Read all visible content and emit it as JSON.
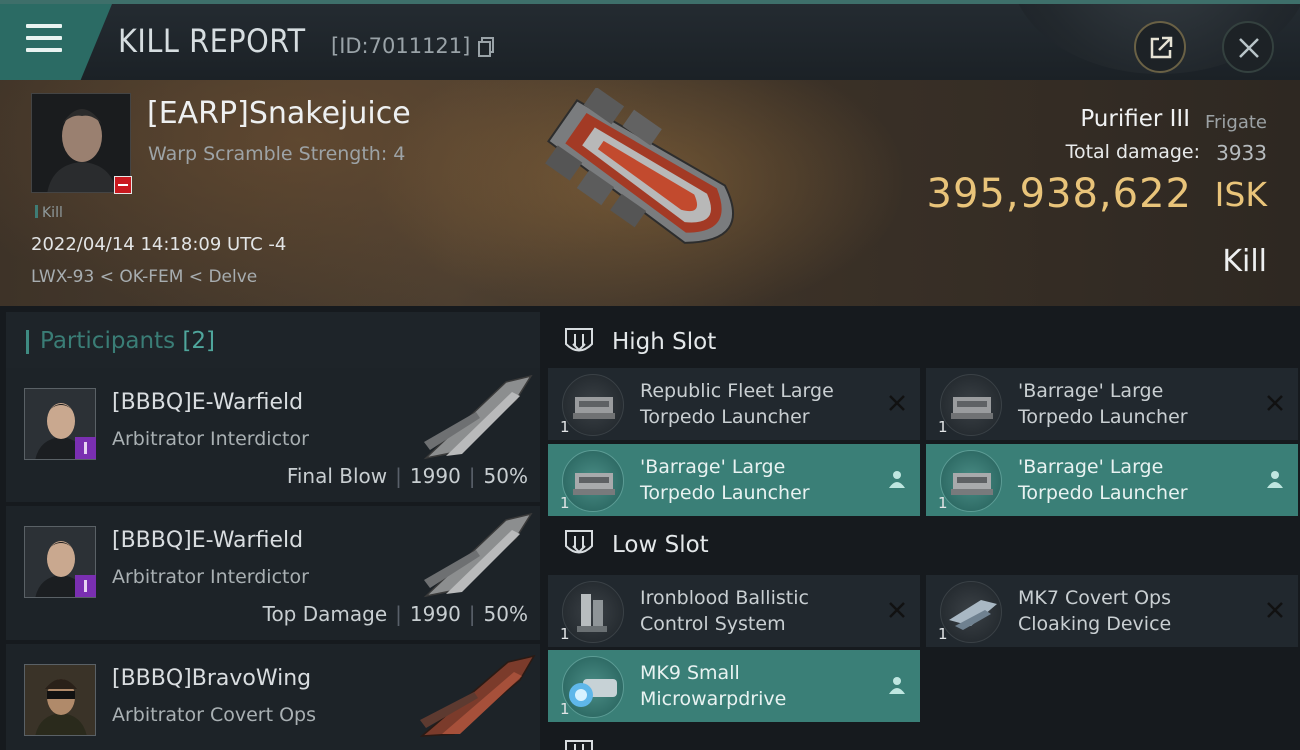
{
  "header": {
    "title": "KILL REPORT",
    "kill_id": "[ID:7011121]"
  },
  "victim": {
    "name": "[EARP]Snakejuice",
    "scramble": "Warp Scramble Strength: 4",
    "tag": "Kill",
    "datetime": "2022/04/14 14:18:09 UTC -4",
    "location": "LWX-93 < OK-FEM < Delve",
    "ship": "Purifier III",
    "ship_class": "Frigate",
    "damage_label": "Total damage:",
    "damage_value": "3933",
    "isk_value": "395,938,622",
    "isk_unit": "ISK",
    "result": "Kill"
  },
  "participants": {
    "title": "Participants",
    "count": "[2]",
    "rows": [
      {
        "name": "[BBBQ]E-Warfield",
        "ship": "Arbitrator Interdictor",
        "role": "Final Blow",
        "damage": "1990",
        "percent": "50%"
      },
      {
        "name": "[BBBQ]E-Warfield",
        "ship": "Arbitrator Interdictor",
        "role": "Top Damage",
        "damage": "1990",
        "percent": "50%"
      },
      {
        "name": "[BBBQ]BravoWing",
        "ship": "Arbitrator Covert Ops"
      }
    ]
  },
  "fitting": {
    "high_slot": {
      "title": "High Slot",
      "modules": [
        {
          "name_line1": "Republic Fleet Large",
          "name_line2": "Torpedo Launcher",
          "qty": "1",
          "state": "destroyed"
        },
        {
          "name_line1": "'Barrage' Large",
          "name_line2": "Torpedo Launcher",
          "qty": "1",
          "state": "destroyed"
        },
        {
          "name_line1": "'Barrage' Large",
          "name_line2": "Torpedo Launcher",
          "qty": "1",
          "state": "dropped"
        },
        {
          "name_line1": "'Barrage' Large",
          "name_line2": "Torpedo Launcher",
          "qty": "1",
          "state": "dropped"
        }
      ]
    },
    "low_slot": {
      "title": "Low Slot",
      "modules": [
        {
          "name_line1": "Ironblood Ballistic",
          "name_line2": "Control System",
          "qty": "1",
          "state": "destroyed"
        },
        {
          "name_line1": "MK7 Covert Ops",
          "name_line2": "Cloaking Device",
          "qty": "1",
          "state": "destroyed"
        },
        {
          "name_line1": "MK9 Small",
          "name_line2": "Microwarpdrive",
          "qty": "1",
          "state": "dropped"
        }
      ]
    }
  },
  "colors": {
    "accent": "#3a7f77",
    "isk": "#e9c47a",
    "status_red": "#c9191f",
    "corp_purple": "#7a2fb1"
  },
  "icons": [
    "menu-icon",
    "copy-icon",
    "share-icon",
    "close-icon",
    "slot-icon",
    "destroyed-icon",
    "dropped-icon"
  ]
}
